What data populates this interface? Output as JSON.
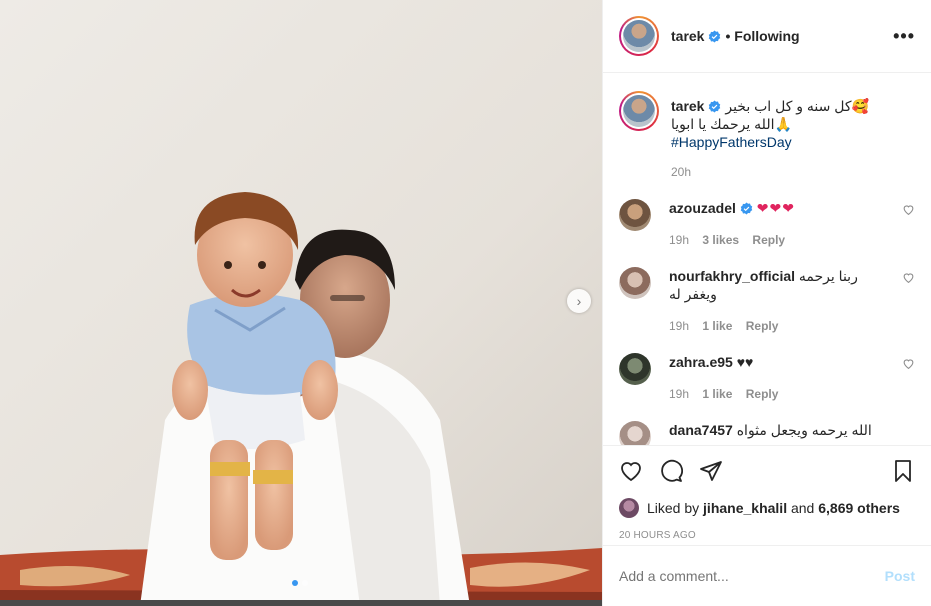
{
  "post": {
    "username": "tarek",
    "follow_status": "Following",
    "more_icon": "ellipsis-icon",
    "caption_line1": "كل سنه و كل اب بخير🥰",
    "caption_line2": "الله يرحمك يا ابويا🙏",
    "hashtag": "#HappyFathersDay",
    "caption_time": "20h",
    "likes_prefix": "Liked by",
    "liked_by_user": "jihane_khalil",
    "likes_and": "and",
    "likes_count": "6,869 others",
    "timestamp": "20 HOURS AGO",
    "add_comment_placeholder": "Add a comment...",
    "post_label": "Post",
    "carousel": {
      "current": 1,
      "total": 2
    }
  },
  "comments": [
    {
      "username": "azouzadel",
      "verified": true,
      "text": "❤❤❤",
      "time": "19h",
      "likes": "3 likes",
      "reply": "Reply",
      "avatar_color": "#8a6a4e"
    },
    {
      "username": "nourfakhry_official",
      "verified": false,
      "text": "ربنا يرحمه ويغفر له",
      "time": "19h",
      "likes": "1 like",
      "reply": "Reply",
      "avatar_color": "#a99284"
    },
    {
      "username": "zahra.e95",
      "verified": false,
      "text": "♥♥",
      "time": "19h",
      "likes": "1 like",
      "reply": "Reply",
      "avatar_color": "#4f5a4a"
    },
    {
      "username": "dana7457",
      "verified": false,
      "text": "الله يرحمه ويجعل مثواه",
      "time": "",
      "likes": "",
      "reply": "",
      "avatar_color": "#c9b7b0"
    }
  ],
  "colors": {
    "link": "#00376b",
    "muted": "#8e8e8e",
    "accent": "#3897f0",
    "post_disabled": "#b2dffc"
  }
}
